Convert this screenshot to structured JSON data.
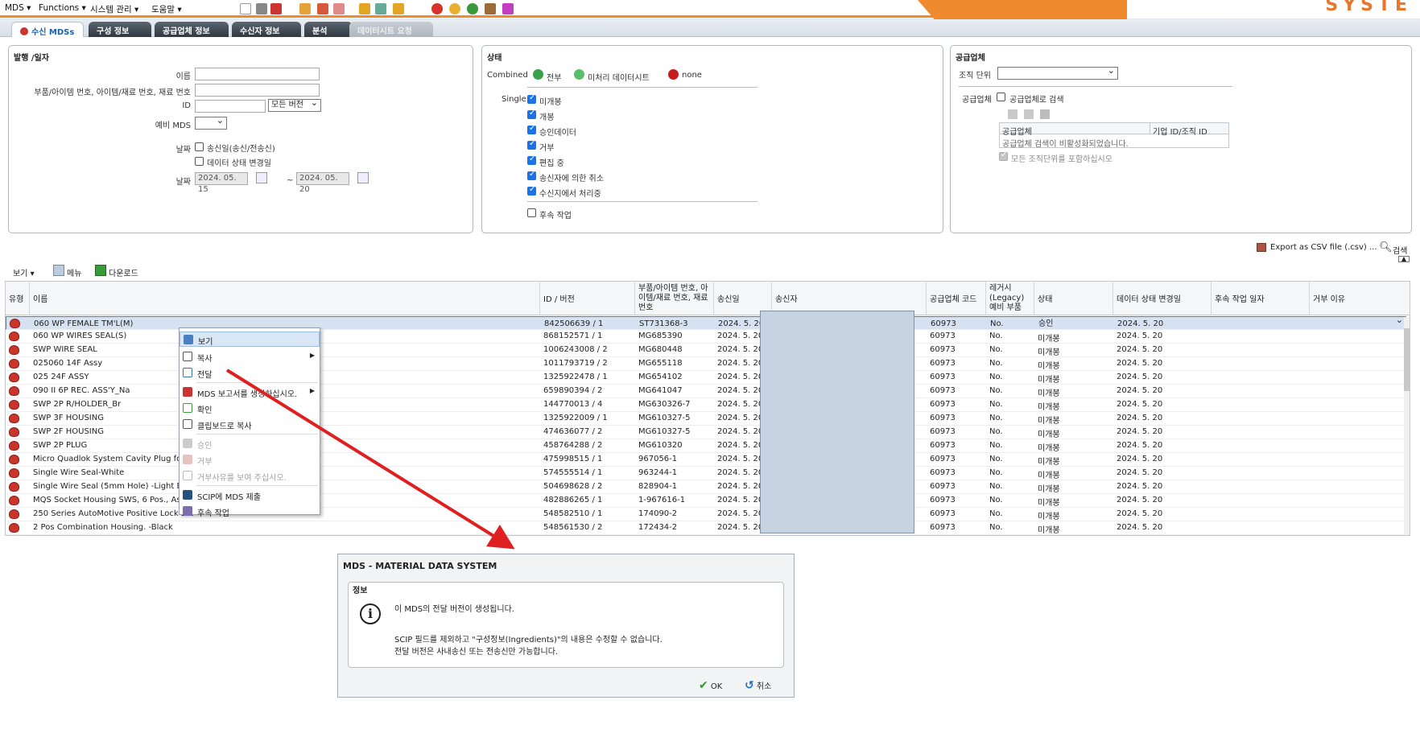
{
  "menu": {
    "items": [
      "MDS ▾",
      "Functions ▾",
      "시스템 관리 ▾",
      "도움말 ▾"
    ],
    "brand": "SYSTE"
  },
  "tabs": [
    {
      "label": "수신 MDSs",
      "active": true
    },
    {
      "label": "구성 정보"
    },
    {
      "label": "공급업체 정보"
    },
    {
      "label": "수신자 정보"
    },
    {
      "label": "분석"
    },
    {
      "label": "데이터시트 요청",
      "disabled": true
    }
  ],
  "panel1": {
    "title": "발행 /일자",
    "name_label": "이름",
    "part_label": "부품/아이템 번호, 아이템/재료 번호, 재료 번호",
    "id_label": "ID",
    "version_select": "모든 버전",
    "spare_label": "예비 MDS",
    "date_label": "날짜",
    "opt_send_date": "송신일(송신/전송신)",
    "opt_status_change": "데이터 상태 변경일",
    "date_label2": "날짜",
    "date_from": "2024. 05. 15",
    "date_to": "2024. 05. 20",
    "tilde": "~"
  },
  "panel2": {
    "title": "상태",
    "combined_label": "Combined",
    "combined_all": "전부",
    "combined_unprocessed": "미처리 데이터시트",
    "combined_none": "none",
    "single_label": "Single",
    "statuses": [
      "미개봉",
      "개봉",
      "승인데이터",
      "거부",
      "편집 중",
      "송신자에 의한 취소",
      "수신지에서 처리중"
    ],
    "followup": "후속 작업"
  },
  "panel3": {
    "title": "공급업체",
    "org_label": "조직 단위",
    "supplier_label": "공급업체",
    "search_by_supplier": "공급업체로 검색",
    "col_supplier": "공급업체",
    "col_company_id": "기업 ID/조직 ID",
    "disabled_msg": "공급업체 검색이 비활성화되었습니다.",
    "include_all_units": "모든 조직단위를 포함하십시오"
  },
  "toolbar": {
    "export_csv": "Export as CSV file (.csv) ...",
    "search": "검색",
    "view": "보기 ▾",
    "menu": "메뉴",
    "download": "다운로드"
  },
  "grid": {
    "columns": [
      "유형",
      "이름",
      "ID / 버전",
      "부품/아이템 번호, 아이템/재료 번호, 재료 번호",
      "송신일",
      "송신자",
      "공급업체 코드",
      "레거시 (Legacy) 예비 부품",
      "상태",
      "데이터 상태 변경일",
      "후속 작업 일자",
      "거부 이유"
    ],
    "rows": [
      {
        "name": "060 WP FEMALE TM'L(M)",
        "id": "842506639 / 1",
        "part": "ST731368-3",
        "date": "2024. 5. 20",
        "code": "60973",
        "legacy": "No.",
        "status": "승인",
        "changed": "2024. 5. 20"
      },
      {
        "name": "060 WP WIRES SEAL(S)",
        "id": "868152571 / 1",
        "part": "MG685390",
        "date": "2024. 5. 20",
        "code": "60973",
        "legacy": "No.",
        "status": "미개봉",
        "changed": "2024. 5. 20"
      },
      {
        "name": "SWP WIRE SEAL",
        "id": "1006243008 / 2",
        "part": "MG680448",
        "date": "2024. 5. 20",
        "code": "60973",
        "legacy": "No.",
        "status": "미개봉",
        "changed": "2024. 5. 20"
      },
      {
        "name": "025060 14F Assy",
        "id": "1011793719 / 2",
        "part": "MG655118",
        "date": "2024. 5. 20",
        "code": "60973",
        "legacy": "No.",
        "status": "미개봉",
        "changed": "2024. 5. 20"
      },
      {
        "name": "025 24F ASSY",
        "id": "1325922478 / 1",
        "part": "MG654102",
        "date": "2024. 5. 20",
        "code": "60973",
        "legacy": "No.",
        "status": "미개봉",
        "changed": "2024. 5. 20"
      },
      {
        "name": "090 II 6P REC. ASS'Y_Na",
        "id": "659890394 / 2",
        "part": "MG641047",
        "date": "2024. 5. 20",
        "code": "60973",
        "legacy": "No.",
        "status": "미개봉",
        "changed": "2024. 5. 20"
      },
      {
        "name": "SWP 2P R/HOLDER_Br",
        "id": "144770013 / 4",
        "part": "MG630326-7",
        "date": "2024. 5. 20",
        "code": "60973",
        "legacy": "No.",
        "status": "미개봉",
        "changed": "2024. 5. 20"
      },
      {
        "name": "SWP 3F HOUSING",
        "id": "1325922009 / 1",
        "part": "MG610327-5",
        "date": "2024. 5. 20",
        "code": "60973",
        "legacy": "No.",
        "status": "미개봉",
        "changed": "2024. 5. 20"
      },
      {
        "name": "SWP 2F HOUSING",
        "id": "474636077 / 2",
        "part": "MG610327-5",
        "date": "2024. 5. 20",
        "code": "60973",
        "legacy": "No.",
        "status": "미개봉",
        "changed": "2024. 5. 20"
      },
      {
        "name": "SWP 2P PLUG",
        "id": "458764288 / 2",
        "part": "MG610320",
        "date": "2024. 5. 20",
        "code": "60973",
        "legacy": "No.",
        "status": "미개봉",
        "changed": "2024. 5. 20"
      },
      {
        "name": "Micro Quadlok System Cavity Plug for C",
        "id": "475998515 / 1",
        "part": "967056-1",
        "date": "2024. 5. 20",
        "code": "60973",
        "legacy": "No.",
        "status": "미개봉",
        "changed": "2024. 5. 20"
      },
      {
        "name": "Single Wire Seal-White",
        "id": "574555514 / 1",
        "part": "963244-1",
        "date": "2024. 5. 20",
        "code": "60973",
        "legacy": "No.",
        "status": "미개봉",
        "changed": "2024. 5. 20"
      },
      {
        "name": "Single Wire Seal (5mm Hole) -Light Blue",
        "id": "504698628 / 2",
        "part": "828904-1",
        "date": "2024. 5. 20",
        "code": "60973",
        "legacy": "No.",
        "status": "미개봉",
        "changed": "2024. 5. 20"
      },
      {
        "name": "MQS Socket Housing SWS, 6 Pos., Ass'y",
        "id": "482886265 / 1",
        "part": "1-967616-1",
        "date": "2024. 5. 20",
        "code": "60973",
        "legacy": "No.",
        "status": "미개봉",
        "changed": "2024. 5. 20"
      },
      {
        "name": "250 Series AutoMotive Positive Lock-Bla",
        "id": "548582510 / 1",
        "part": "174090-2",
        "date": "2024. 5. 20",
        "code": "60973",
        "legacy": "No.",
        "status": "미개봉",
        "changed": "2024. 5. 20"
      },
      {
        "name": "2 Pos Combination Housing. -Black",
        "id": "548561530 / 2",
        "part": "172434-2",
        "date": "2024. 5. 20",
        "code": "60973",
        "legacy": "No.",
        "status": "미개봉",
        "changed": "2024. 5. 20"
      }
    ]
  },
  "context_menu": {
    "view": "보기",
    "copy": "복사",
    "forward": "전달",
    "report": "MDS 보고서를 생성하십시오.",
    "check": "확인",
    "clipboard": "클립보드로 복사",
    "approve": "승인",
    "reject": "거부",
    "reject_reason": "거부사유를 보여 주십시오.",
    "scip": "SCIP에 MDS 제출",
    "followup": "후속 작업"
  },
  "dialog": {
    "title": "MDS - MATERIAL DATA SYSTEM",
    "section": "정보",
    "line1": "이 MDS의 전달 버전이 생성됩니다.",
    "line2": "SCIP 필드를 제외하고 \"구성정보(Ingredients)\"의 내용은 수정할 수 없습니다.",
    "line3": "전달 버전은 사내송신 또는 전송신만 가능합니다.",
    "ok": "OK",
    "cancel": "취소"
  }
}
